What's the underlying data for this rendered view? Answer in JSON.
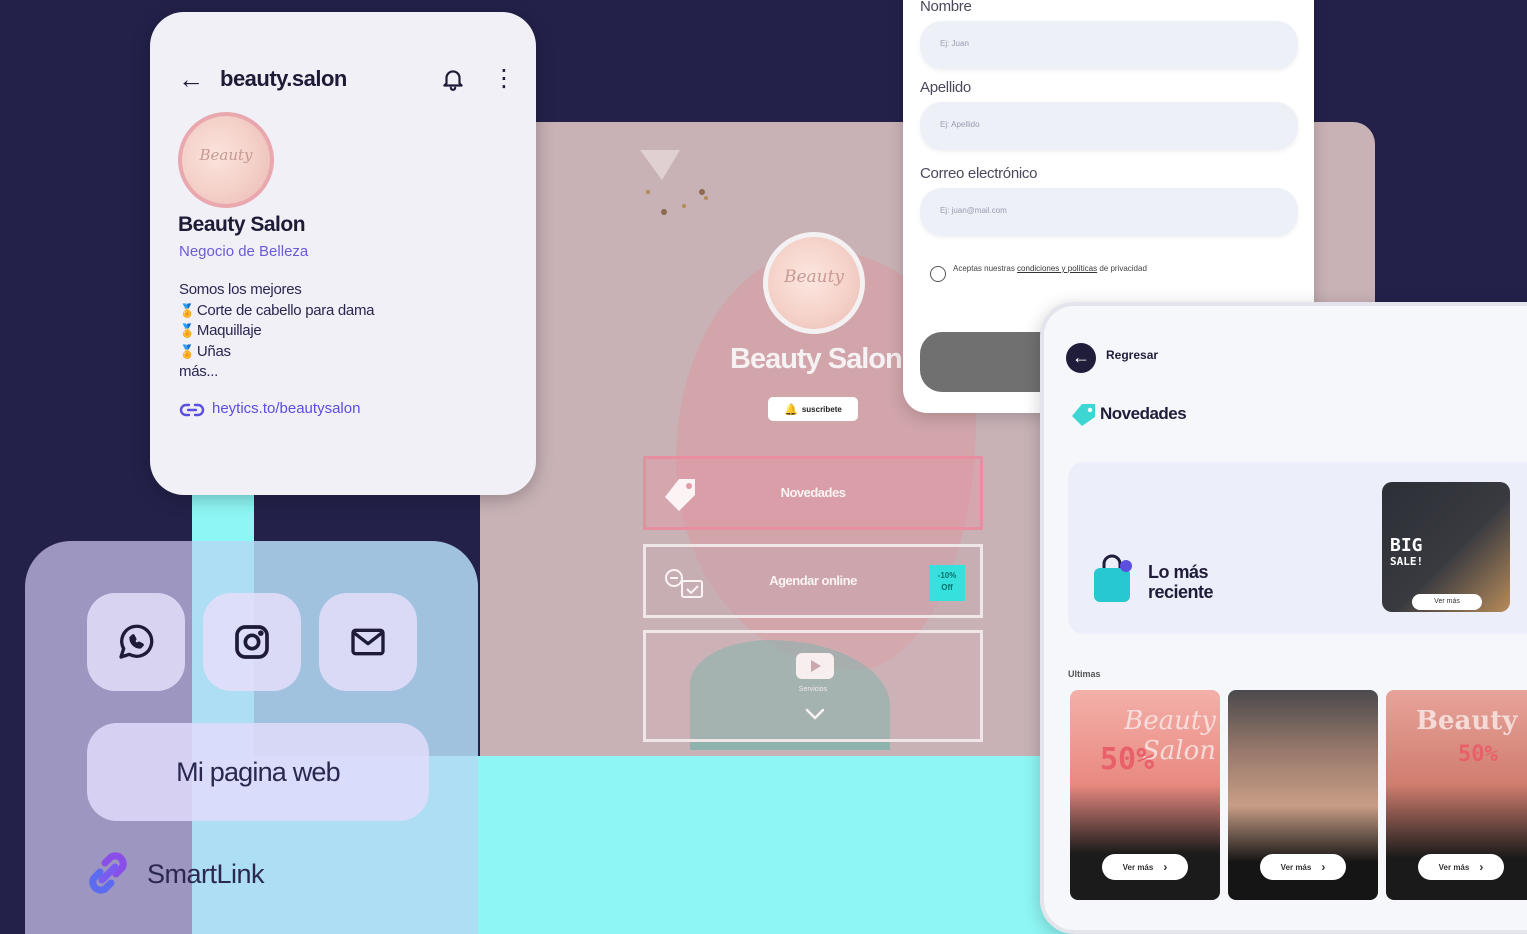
{
  "phone": {
    "handle": "beauty.salon",
    "avatar_text": "Beauty",
    "name": "Beauty Salon",
    "category": "Negocio de Belleza",
    "bio_intro": "Somos los mejores",
    "bio_items": [
      "Corte de cabello para dama",
      "Maquillaje",
      "Uñas"
    ],
    "bio_more": "más...",
    "link": "heytics.to/beautysalon"
  },
  "contact": {
    "icons": [
      "whatsapp-icon",
      "instagram-icon",
      "mail-icon"
    ],
    "web_button": "Mi pagina web",
    "brand": "SmartLink"
  },
  "profile": {
    "avatar_text": "Beauty",
    "name": "Beauty Salon",
    "subscribe": "suscribete",
    "buttons": {
      "novedades": "Novedades",
      "agendar": "Agendar online",
      "promo_badge_line1": "-10%",
      "promo_badge_line2": "Off",
      "video_label": "Servicios"
    }
  },
  "form": {
    "nombre_label": "Nombre",
    "nombre_placeholder": "Ej: Juan",
    "apellido_label": "Apellido",
    "apellido_placeholder": "Ej: Apellido",
    "correo_label": "Correo electrónico",
    "correo_placeholder": "Ej: juan@mail.com",
    "accept_prefix": "Aceptas nuestras ",
    "accept_link": "condiciones y políticas",
    "accept_suffix": " de privacidad"
  },
  "news": {
    "back": "Regresar",
    "title": "Novedades",
    "banner_line1": "Lo más",
    "banner_line2": "reciente",
    "sale_text_1": "BIG",
    "sale_text_2": "SALE!",
    "sale_pill": "Ver más",
    "section_label": "Ultimas",
    "posts": [
      {
        "title": "Beauty Salon",
        "percent": "50%",
        "pill": "Ver más"
      },
      {
        "title": "",
        "percent": "",
        "pill": "Ver más"
      },
      {
        "title": "Beauty",
        "percent": "50%",
        "pill": "Ver más"
      }
    ]
  },
  "colors": {
    "background": "#23214a",
    "accent": "#6b5bd6",
    "cyan": "#8ef6f4",
    "pink_panel": "#c8b2b6"
  }
}
